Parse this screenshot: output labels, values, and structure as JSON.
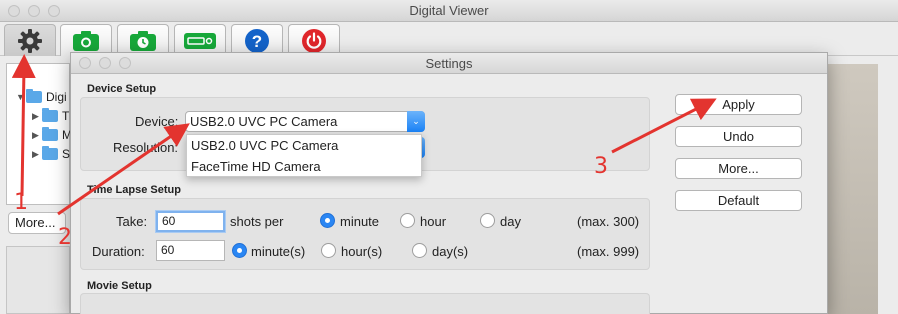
{
  "main_window": {
    "title": "Digital Viewer"
  },
  "toolbar": {
    "buttons": [
      {
        "name": "settings",
        "icon": "gear-icon"
      },
      {
        "name": "snapshot",
        "icon": "camera-icon"
      },
      {
        "name": "timer_snapshot",
        "icon": "timer-camera-icon"
      },
      {
        "name": "record_video",
        "icon": "video-camera-icon"
      },
      {
        "name": "help",
        "icon": "help-icon"
      },
      {
        "name": "quit",
        "icon": "power-icon"
      }
    ]
  },
  "sidebar": {
    "tree": [
      {
        "label": "Digi",
        "expanded": true
      },
      {
        "label": "T"
      },
      {
        "label": "M"
      },
      {
        "label": "S"
      }
    ],
    "more_label": "More..."
  },
  "dialog": {
    "title": "Settings",
    "device_setup": {
      "section_title": "Device Setup",
      "device_label": "Device:",
      "device_value": "USB2.0 UVC PC Camera",
      "resolution_label": "Resolution:",
      "device_options": [
        "USB2.0 UVC PC Camera",
        "FaceTime HD Camera"
      ]
    },
    "time_lapse": {
      "section_title": "Time Lapse Setup",
      "take_label": "Take:",
      "take_value": "60",
      "shots_per_label": "shots per",
      "take_units": [
        "minute",
        "hour",
        "day"
      ],
      "take_selected": "minute",
      "take_max": "(max. 300)",
      "duration_label": "Duration:",
      "duration_value": "60",
      "duration_units": [
        "minute(s)",
        "hour(s)",
        "day(s)"
      ],
      "duration_selected": "minute(s)",
      "duration_max": "(max. 999)"
    },
    "movie_setup": {
      "section_title": "Movie Setup"
    },
    "buttons": {
      "apply": "Apply",
      "undo": "Undo",
      "more": "More...",
      "default": "Default"
    }
  },
  "annotations": {
    "step1": "1",
    "step2": "2",
    "step3": "3"
  },
  "colors": {
    "accent_blue": "#2a86f3",
    "annotation_red": "#e3342f"
  }
}
